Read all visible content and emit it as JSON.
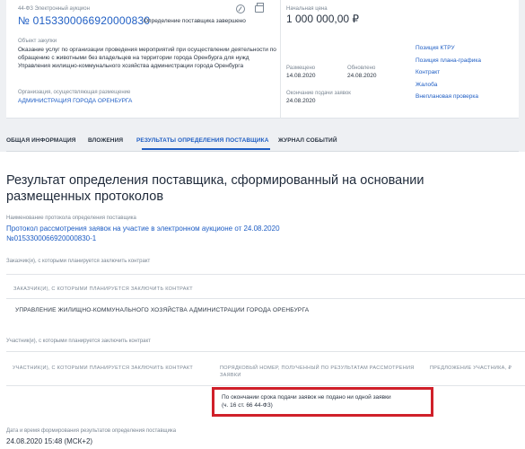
{
  "header": {
    "law": "44-ФЗ Электронный аукцион",
    "reg_number": "№ 0153300066920000830",
    "status": "Определение поставщика завершено",
    "object_label": "Объект закупки",
    "object_text": "Оказание услуг по организации проведения мероприятий при осуществлении деятельности по обращению с животными без владельцев на территории города Оренбурга для нужд Управления жилищно-коммунального хозяйства администрации города Оренбурга",
    "org_label": "Организация, осуществляющая размещение",
    "org_name": "АДМИНИСТРАЦИЯ ГОРОДА ОРЕНБУРГА",
    "price_label": "Начальная цена",
    "price_value": "1 000 000,00 ₽",
    "posted_label": "Размещено",
    "posted_date": "14.08.2020",
    "updated_label": "Обновлено",
    "updated_date": "24.08.2020",
    "deadline_label": "Окончание подачи заявок",
    "deadline_date": "24.08.2020",
    "side_links": [
      "Позиция КТРУ",
      "Позиция плана-графика",
      "Контракт",
      "Жалоба",
      "Внеплановая проверка"
    ]
  },
  "tabs": [
    {
      "label": "ОБЩАЯ ИНФОРМАЦИЯ",
      "active": false
    },
    {
      "label": "ВЛОЖЕНИЯ",
      "active": false
    },
    {
      "label": "РЕЗУЛЬТАТЫ ОПРЕДЕЛЕНИЯ ПОСТАВЩИКА",
      "active": true
    },
    {
      "label": "ЖУРНАЛ СОБЫТИЙ",
      "active": false
    }
  ],
  "main": {
    "title": "Результат определения поставщика, сформированный на основании размещенных протоколов",
    "protocol_label": "Наименование протокола определения поставщика",
    "protocol_link": "Протокол рассмотрения заявок на участие в электронном аукционе от 24.08.2020 №0153300066920000830-1",
    "customers_label": "Заказчик(и), с которыми планируется заключить контракт",
    "customers_header": "ЗАКАЗЧИК(И), С КОТОРЫМИ ПЛАНИРУЕТСЯ ЗАКЛЮЧИТЬ КОНТРАКТ",
    "customer_name": "УПРАВЛЕНИЕ ЖИЛИЩНО-КОММУНАЛЬНОГО ХОЗЯЙСТВА АДМИНИСТРАЦИИ ГОРОДА ОРЕНБУРГА",
    "participants_label": "Участник(и), с которыми планируется заключить контракт",
    "participants_headers": [
      "УЧАСТНИК(И), С КОТОРЫМИ ПЛАНИРУЕТСЯ ЗАКЛЮЧИТЬ КОНТРАКТ",
      "ПОРЯДКОВЫЙ НОМЕР, ПОЛУЧЕННЫЙ ПО РЕЗУЛЬТАТАМ РАССМОТРЕНИЯ ЗАЯВКИ",
      "ПРЕДЛОЖЕНИЕ УЧАСТНИКА, ₽"
    ],
    "notice_line1": "По окончании срока подачи заявок не подано ни одной заявки",
    "notice_line2": "(ч. 16 ст. 66 44-ФЗ)",
    "date_label": "Дата и время формирования результатов определения поставщика",
    "date_value": "24.08.2020 15:48 (МСК+2)"
  }
}
